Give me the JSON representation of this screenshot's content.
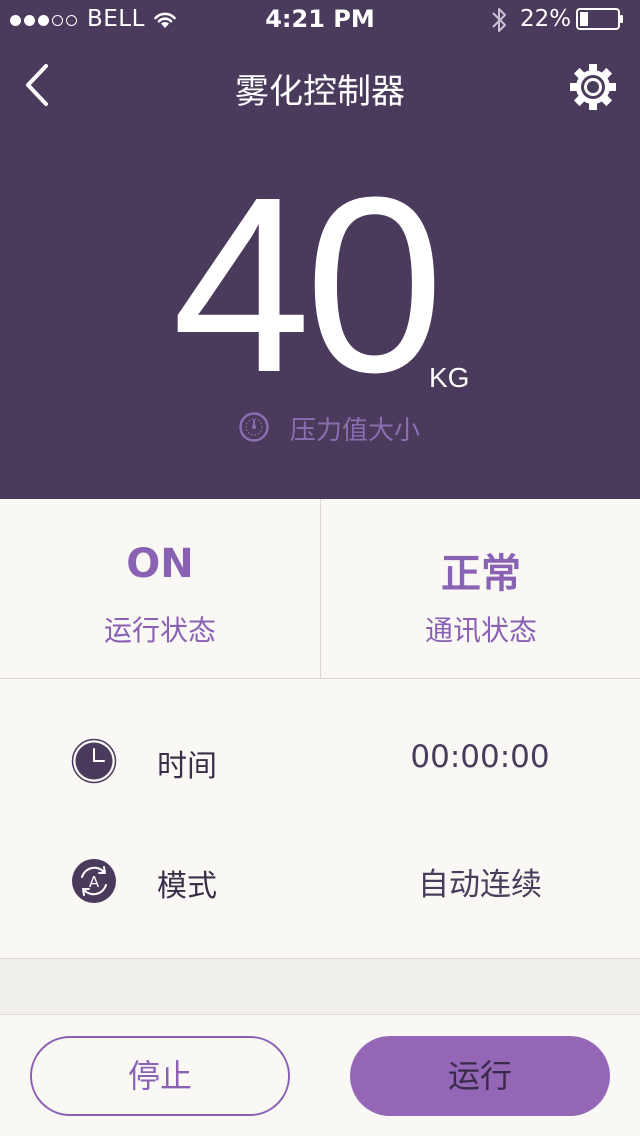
{
  "status_bar": {
    "carrier": "BELL",
    "time": "4:21 PM",
    "battery_percent": "22%",
    "battery_level": 0.22,
    "signal_bars_filled": 3,
    "signal_bars_total": 5
  },
  "nav": {
    "title": "雾化控制器",
    "back_icon": "chevron-left-icon",
    "settings_icon": "gear-icon"
  },
  "pressure": {
    "value": "40",
    "unit": "KG",
    "label": "压力值大小",
    "icon": "gauge-icon"
  },
  "status": {
    "run": {
      "value": "ON",
      "label": "运行状态"
    },
    "comm": {
      "value": "正常",
      "label": "通讯状态"
    }
  },
  "info": {
    "time": {
      "label": "时间",
      "value": "00:00:00",
      "icon": "clock-icon"
    },
    "mode": {
      "label": "模式",
      "value": "自动连续",
      "icon": "auto-mode-icon"
    }
  },
  "buttons": {
    "stop": "停止",
    "run": "运行"
  },
  "colors": {
    "header_bg": "#4a3a5c",
    "accent": "#8a62b4",
    "page_bg": "#faf8f5",
    "run_button_bg": "#9366b6"
  }
}
